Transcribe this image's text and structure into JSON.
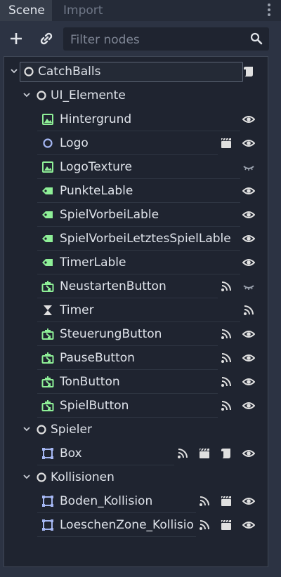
{
  "tabs": [
    {
      "label": "Scene",
      "active": true
    },
    {
      "label": "Import",
      "active": false
    }
  ],
  "toolbar": {
    "add_icon": "plus-icon",
    "link_icon": "link-icon",
    "search_placeholder": "Filter nodes",
    "search_value": ""
  },
  "colors": {
    "accent_green": "#8eef97",
    "accent_blue": "#a5b7f3",
    "node_white": "#e0e0e0",
    "eye": "#e0e0e0"
  },
  "tree": {
    "nodes": [
      {
        "name": "CatchBalls",
        "icon": "node-icon",
        "level": 0,
        "expanded": true,
        "selected": true,
        "badges": [
          "script-icon"
        ]
      },
      {
        "name": "UI_Elemente",
        "icon": "node-icon",
        "level": 1,
        "expanded": true,
        "badges": []
      },
      {
        "name": "Hintergrund",
        "icon": "texture-rect-icon",
        "level": 2,
        "badges": [
          "eye-icon"
        ]
      },
      {
        "name": "Logo",
        "icon": "node2d-icon",
        "level": 2,
        "badges": [
          "instance-icon",
          "eye-icon"
        ]
      },
      {
        "name": "LogoTexture",
        "icon": "texture-rect-icon",
        "level": 2,
        "badges": [
          "eye-closed-icon"
        ]
      },
      {
        "name": "PunkteLable",
        "icon": "label-icon",
        "level": 2,
        "badges": [
          "eye-icon"
        ]
      },
      {
        "name": "SpielVorbeiLable",
        "icon": "label-icon",
        "level": 2,
        "badges": [
          "eye-icon"
        ]
      },
      {
        "name": "SpielVorbeiLetztesSpielLable",
        "icon": "label-icon",
        "level": 2,
        "badges": [
          "eye-icon"
        ]
      },
      {
        "name": "TimerLable",
        "icon": "label-icon",
        "level": 2,
        "badges": [
          "eye-icon"
        ]
      },
      {
        "name": "NeustartenButton",
        "icon": "texture-button-icon",
        "level": 2,
        "badges": [
          "signal-icon",
          "eye-closed-icon"
        ]
      },
      {
        "name": "Timer",
        "icon": "timer-icon",
        "level": 2,
        "badges": [
          "signal-icon"
        ]
      },
      {
        "name": "SteuerungButton",
        "icon": "texture-button-icon",
        "level": 2,
        "badges": [
          "signal-icon",
          "eye-icon"
        ]
      },
      {
        "name": "PauseButton",
        "icon": "texture-button-icon",
        "level": 2,
        "badges": [
          "signal-icon",
          "eye-icon"
        ]
      },
      {
        "name": "TonButton",
        "icon": "texture-button-icon",
        "level": 2,
        "badges": [
          "signal-icon",
          "eye-icon"
        ]
      },
      {
        "name": "SpielButton",
        "icon": "texture-button-icon",
        "level": 2,
        "badges": [
          "signal-icon",
          "eye-icon"
        ]
      },
      {
        "name": "Spieler",
        "icon": "node-icon",
        "level": 1,
        "expanded": true,
        "badges": []
      },
      {
        "name": "Box",
        "icon": "area-icon",
        "level": 2,
        "badges": [
          "signal-icon",
          "instance-icon",
          "script-icon",
          "eye-icon"
        ]
      },
      {
        "name": "Kollisionen",
        "icon": "node-icon",
        "level": 1,
        "expanded": true,
        "badges": []
      },
      {
        "name": "Boden_Kollision",
        "icon": "area-icon",
        "level": 2,
        "badges": [
          "signal-icon",
          "instance-icon",
          "eye-icon"
        ]
      },
      {
        "name": "LoeschenZone_Kollisio",
        "icon": "area-icon",
        "level": 2,
        "badges": [
          "signal-icon",
          "instance-icon",
          "eye-icon"
        ]
      }
    ]
  }
}
